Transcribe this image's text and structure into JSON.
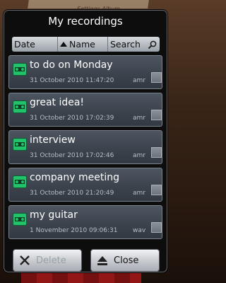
{
  "background": {
    "top_text": "Settings   Album"
  },
  "dialog": {
    "title": "My recordings"
  },
  "sort_bar": {
    "date_label": "Date",
    "name_label": "Name",
    "search_label": "Search"
  },
  "recordings": [
    {
      "title": "to do on Monday",
      "date": "31 October 2010 11:47:20",
      "ext": "amr"
    },
    {
      "title": "great idea!",
      "date": "31 October 2010 17:02:39",
      "ext": "amr"
    },
    {
      "title": "interview",
      "date": "31 October 2010 17:02:46",
      "ext": "amr"
    },
    {
      "title": "company meeting",
      "date": "31 October 2010 21:20:49",
      "ext": "amr"
    },
    {
      "title": "my guitar",
      "date": "1 November 2010 09:06:31",
      "ext": "wav"
    }
  ],
  "buttons": {
    "delete_label": "Delete",
    "close_label": "Close"
  },
  "icons": {
    "recording": "tape-recording-icon",
    "sort": "sort-up-triangle-icon",
    "search": "magnifier-icon",
    "delete": "x-icon",
    "close": "eject-icon"
  },
  "colors": {
    "accent_green": "#22c26a",
    "row_bg": "#414852"
  }
}
